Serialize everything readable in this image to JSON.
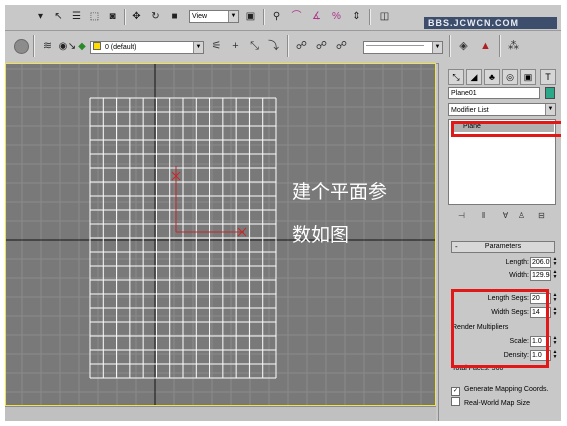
{
  "toolbar": {
    "view_dropdown": "View",
    "layer_dropdown": "0 (default)",
    "icons": [
      "select-icon",
      "select-by-name-icon",
      "region-select-icon",
      "window-crossing-icon",
      "move-icon",
      "rotate-icon",
      "scale-icon",
      "view-dropdown",
      "pivot-icon",
      "manipulate-icon",
      "snap-icon",
      "angle-snap-icon",
      "percent-snap-icon",
      "spinner-snap-icon",
      "named-selection-icon"
    ],
    "watermark": "BBS.JCWCN.COM"
  },
  "viewport": {
    "annotation_line1": "建个平面参",
    "annotation_line2": "数如图",
    "colors": {
      "background": "#797979",
      "grid": "#8a8a8a",
      "axis": "#141414",
      "mesh": "#ffffff",
      "gizmo": "#c02a2a",
      "active_border": "#f2e34a"
    },
    "plane_segments": {
      "length_segs": 20,
      "width_segs": 14
    }
  },
  "command_panel": {
    "object_name": "Plane01",
    "object_color": "#2aa889",
    "modifier_list_label": "Modifier List",
    "stack_item": "Plane",
    "parameters": {
      "rollout_title": "Parameters",
      "length_label": "Length:",
      "length_value": "206.091",
      "width_label": "Width:",
      "width_value": "129.949",
      "length_segs_label": "Length Segs:",
      "length_segs_value": "20",
      "width_segs_label": "Width Segs:",
      "width_segs_value": "14",
      "render_multipliers_label": "Render Multipliers",
      "scale_label": "Scale:",
      "scale_value": "1.0",
      "density_label": "Density:",
      "density_value": "1.0",
      "total_faces_label": "Total Faces: 560",
      "generate_mapping_label": "Generate Mapping Coords.",
      "generate_mapping_checked": true,
      "realworld_label": "Real-World Map Size",
      "realworld_checked": false
    },
    "highlight_color": "#e01818"
  }
}
